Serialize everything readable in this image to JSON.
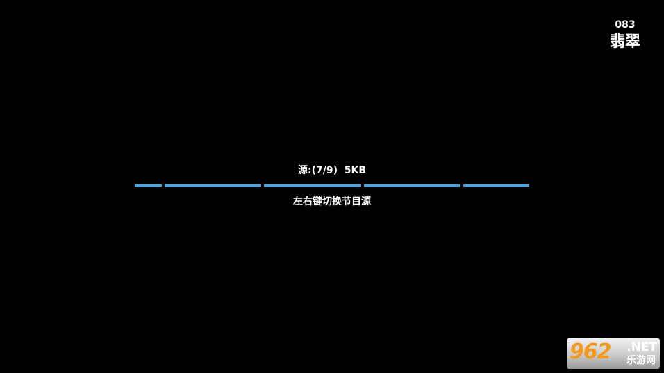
{
  "channel": {
    "number": "083",
    "name": "翡翠"
  },
  "source": {
    "status": "源:(7/9)  5KB",
    "hint": "左右键切换节目源"
  },
  "progress": {
    "color": "#4aa6de",
    "segment_count": 5
  },
  "watermark": {
    "digits": "962",
    "suffix": ".NET",
    "name": "乐游网",
    "digits_color": "#f39a1e"
  }
}
